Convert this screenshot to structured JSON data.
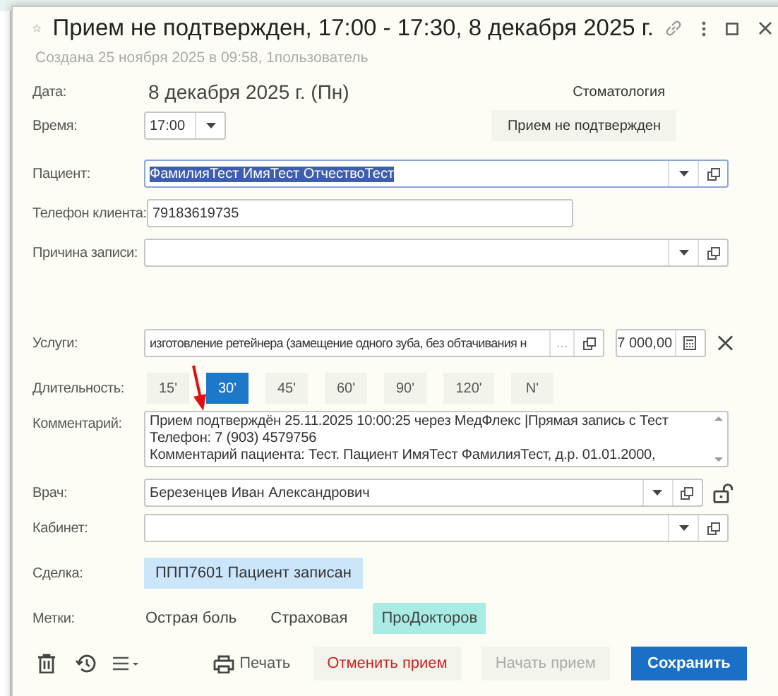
{
  "window": {
    "title": "Прием не подтвержден, 17:00 - 17:30, 8 декабря 2025 г.",
    "favorite": false
  },
  "created": "Создана 25 ноября 2025  в 09:58, 1пользователь",
  "date": {
    "label": "Дата:",
    "value": "8 декабря 2025 г. (Пн)"
  },
  "department": "Стоматология",
  "time": {
    "label": "Время:",
    "value": "17:00"
  },
  "status_button": "Прием не подтвержден",
  "patient": {
    "label": "Пациент:",
    "value": "ФамилияТест ИмяТест ОтчествоТест",
    "text_selected": true
  },
  "phone": {
    "label": "Телефон клиента:",
    "value": "79183619735"
  },
  "reason": {
    "label": "Причина записи:"
  },
  "services": {
    "label": "Услуги:",
    "value": "изготовление ретейнера (замещение одного зуба, без обтачивания н",
    "more": "...",
    "price": "7 000,00"
  },
  "duration": {
    "label": "Длительность:",
    "options": [
      {
        "label": "15'",
        "selected": false
      },
      {
        "label": "30'",
        "selected": true
      },
      {
        "label": "45'",
        "selected": false
      },
      {
        "label": "60'",
        "selected": false
      },
      {
        "label": "90'",
        "selected": false
      },
      {
        "label": "120'",
        "selected": false
      },
      {
        "label": "N'",
        "selected": false
      }
    ]
  },
  "comment": {
    "label": "Комментарий:",
    "lines": [
      "Прием подтверждён 25.11.2025 10:00:25 через МедФлекс |Прямая запись с Тест",
      "Телефон: 7 (903) 4579756",
      "Комментарий пациента: Тест. Пациент ИмяТест ФамилияТест, д.р. 01.01.2000,"
    ]
  },
  "doctor": {
    "label": "Врач:",
    "value": "Березенцев Иван Александрович",
    "locked": false
  },
  "room": {
    "label": "Кабинет:"
  },
  "deal": {
    "label": "Сделка:",
    "value": "ППП7601  Пациент записан"
  },
  "tags": {
    "label": "Метки:",
    "items": [
      {
        "label": "Острая боль",
        "selected": false
      },
      {
        "label": "Страховая",
        "selected": false
      },
      {
        "label": "ПроДокторов",
        "selected": true
      }
    ]
  },
  "footer": {
    "print": "Печать",
    "cancel": "Отменить прием",
    "start": {
      "label": "Начать прием",
      "disabled": true
    },
    "save": "Сохранить"
  }
}
